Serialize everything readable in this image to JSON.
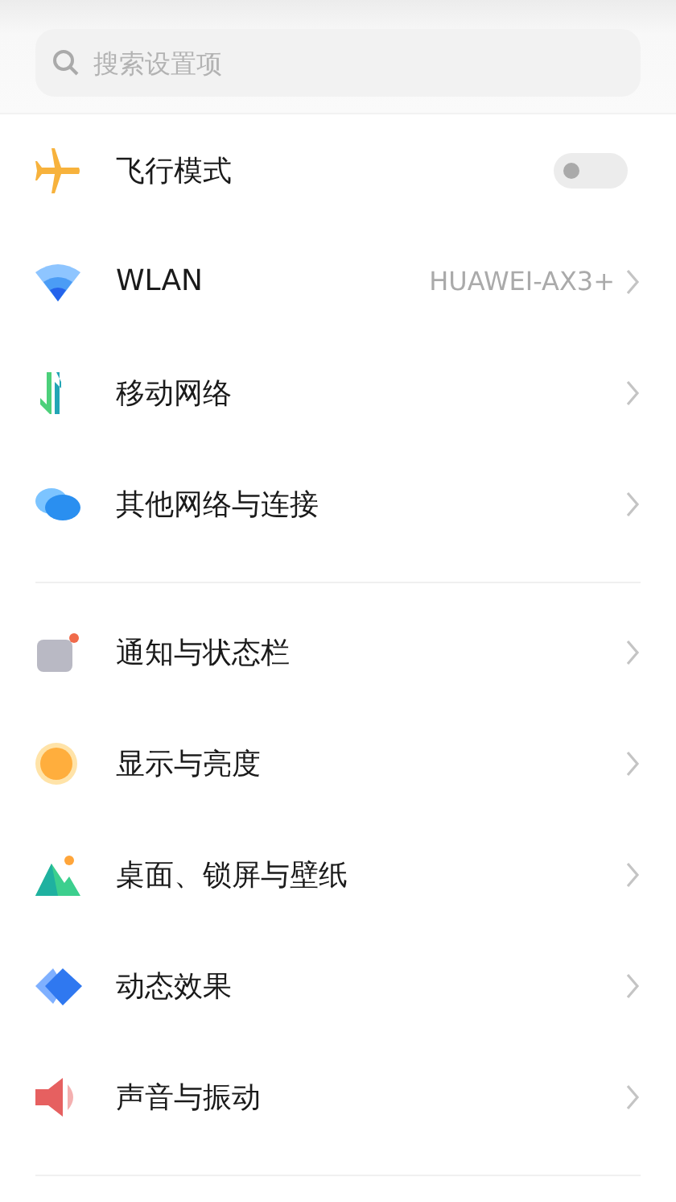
{
  "search": {
    "placeholder": "搜索设置项"
  },
  "groups": [
    {
      "items": [
        {
          "kind": "toggle",
          "label": "飞行模式",
          "on": false
        },
        {
          "kind": "link",
          "label": "WLAN",
          "value": "HUAWEI-AX3+"
        },
        {
          "kind": "link",
          "label": "移动网络"
        },
        {
          "kind": "link",
          "label": "其他网络与连接"
        }
      ]
    },
    {
      "items": [
        {
          "kind": "link",
          "label": "通知与状态栏"
        },
        {
          "kind": "link",
          "label": "显示与亮度"
        },
        {
          "kind": "link",
          "label": "桌面、锁屏与壁纸"
        },
        {
          "kind": "link",
          "label": "动态效果"
        },
        {
          "kind": "link",
          "label": "声音与振动"
        }
      ]
    }
  ]
}
